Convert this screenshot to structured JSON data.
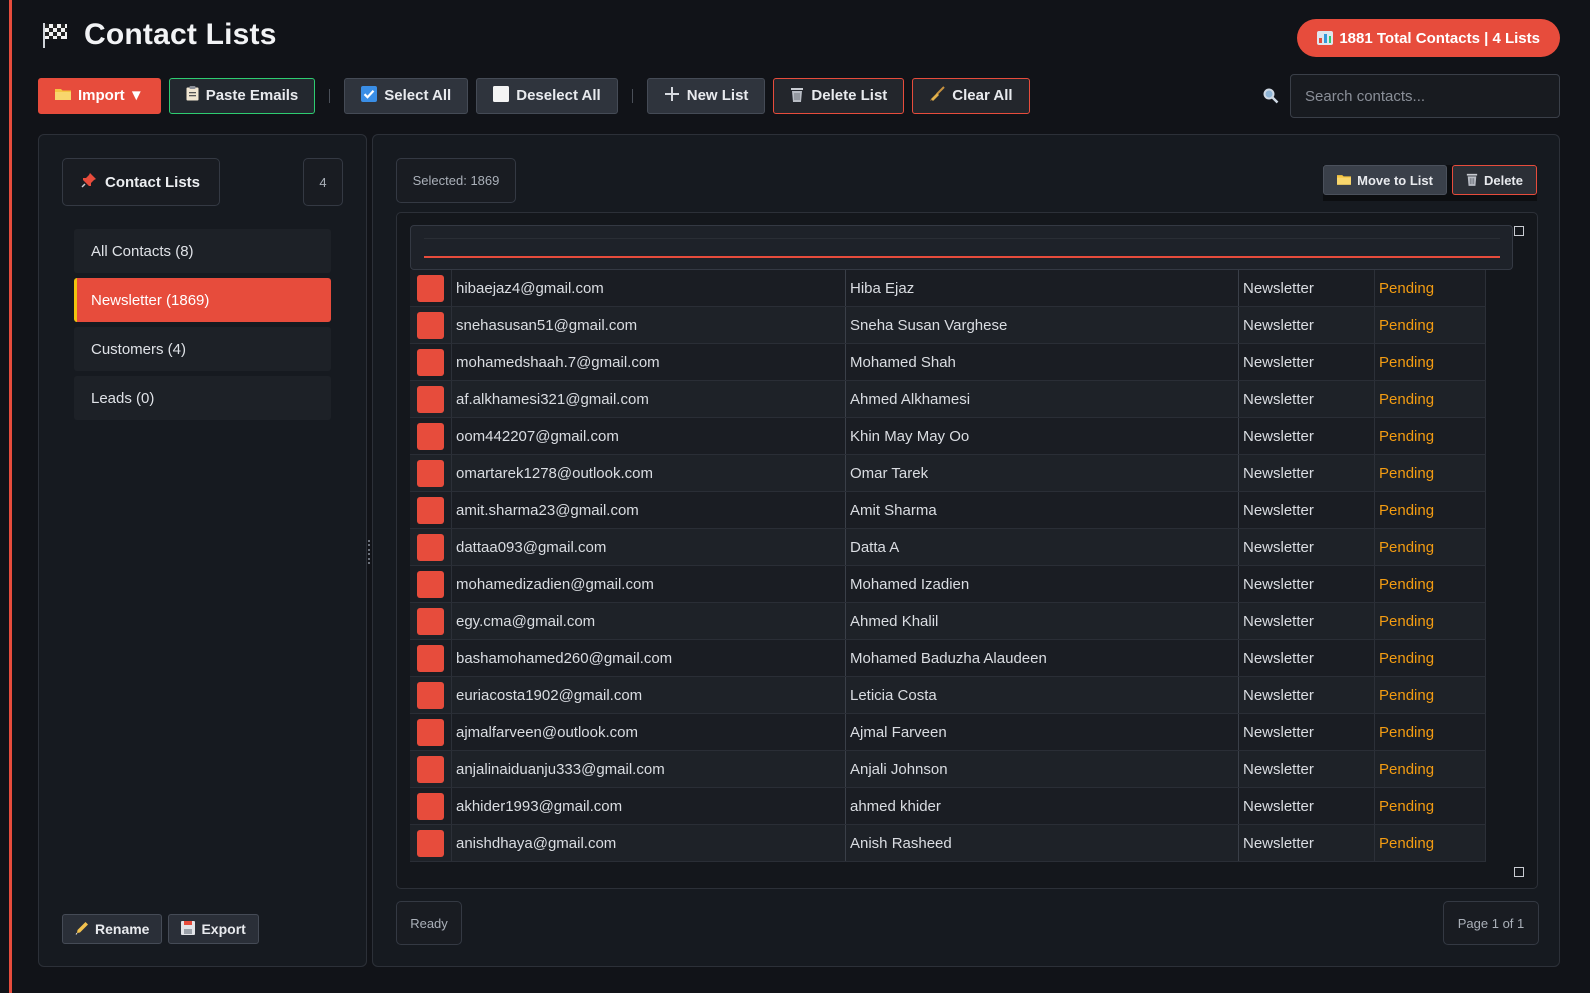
{
  "app": {
    "title": "Contact Lists",
    "total_badge": "1881 Total Contacts | 4 Lists"
  },
  "toolbar": {
    "import_label": "Import ▼",
    "paste_label": "Paste Emails",
    "select_all_label": "Select All",
    "deselect_all_label": "Deselect All",
    "new_list_label": "New List",
    "delete_list_label": "Delete List",
    "clear_all_label": "Clear All"
  },
  "search": {
    "placeholder": "Search contacts...",
    "value": ""
  },
  "sidebar": {
    "title": "Contact Lists",
    "count": "4",
    "items": [
      {
        "label": "All Contacts (8)",
        "active": false
      },
      {
        "label": "Newsletter (1869)",
        "active": true
      },
      {
        "label": "Customers (4)",
        "active": false
      },
      {
        "label": "Leads (0)",
        "active": false
      }
    ],
    "rename_label": "Rename",
    "export_label": "Export"
  },
  "main": {
    "selected_text": "Selected: 1869",
    "move_label": "Move to List",
    "delete_label": "Delete",
    "status_text": "Ready",
    "page_text": "Page 1 of 1"
  },
  "rows": [
    {
      "email": "hibaejaz4@gmail.com",
      "name": "Hiba Ejaz",
      "list": "Newsletter",
      "status": "Pending"
    },
    {
      "email": "snehasusan51@gmail.com",
      "name": "Sneha Susan Varghese",
      "list": "Newsletter",
      "status": "Pending"
    },
    {
      "email": "mohamedshaah.7@gmail.com",
      "name": "Mohamed Shah",
      "list": "Newsletter",
      "status": "Pending"
    },
    {
      "email": "af.alkhamesi321@gmail.com",
      "name": "Ahmed Alkhamesi",
      "list": "Newsletter",
      "status": "Pending"
    },
    {
      "email": "oom442207@gmail.com",
      "name": "Khin May May Oo",
      "list": "Newsletter",
      "status": "Pending"
    },
    {
      "email": "omartarek1278@outlook.com",
      "name": "Omar Tarek",
      "list": "Newsletter",
      "status": "Pending"
    },
    {
      "email": "amit.sharma23@gmail.com",
      "name": "Amit Sharma",
      "list": "Newsletter",
      "status": "Pending"
    },
    {
      "email": "dattaa093@gmail.com",
      "name": "Datta A",
      "list": "Newsletter",
      "status": "Pending"
    },
    {
      "email": "mohamedizadien@gmail.com",
      "name": "Mohamed Izadien",
      "list": "Newsletter",
      "status": "Pending"
    },
    {
      "email": "egy.cma@gmail.com",
      "name": "Ahmed Khalil",
      "list": "Newsletter",
      "status": "Pending"
    },
    {
      "email": "bashamohamed260@gmail.com",
      "name": "Mohamed Baduzha Alaudeen",
      "list": "Newsletter",
      "status": "Pending"
    },
    {
      "email": "euriacosta1902@gmail.com",
      "name": "Leticia Costa",
      "list": "Newsletter",
      "status": "Pending"
    },
    {
      "email": "ajmalfarveen@outlook.com",
      "name": "Ajmal Farveen",
      "list": "Newsletter",
      "status": "Pending"
    },
    {
      "email": "anjalinaiduanju333@gmail.com",
      "name": "Anjali Johnson",
      "list": "Newsletter",
      "status": "Pending"
    },
    {
      "email": "akhider1993@gmail.com",
      "name": "ahmed khider",
      "list": "Newsletter",
      "status": "Pending"
    },
    {
      "email": "anishdhaya@gmail.com",
      "name": "Anish Rasheed",
      "list": "Newsletter",
      "status": "Pending"
    }
  ],
  "colors": {
    "accent": "#e74c3c",
    "pending": "#f39c12",
    "active_border": "#f1c40f",
    "paste_border": "#2ecc71"
  }
}
